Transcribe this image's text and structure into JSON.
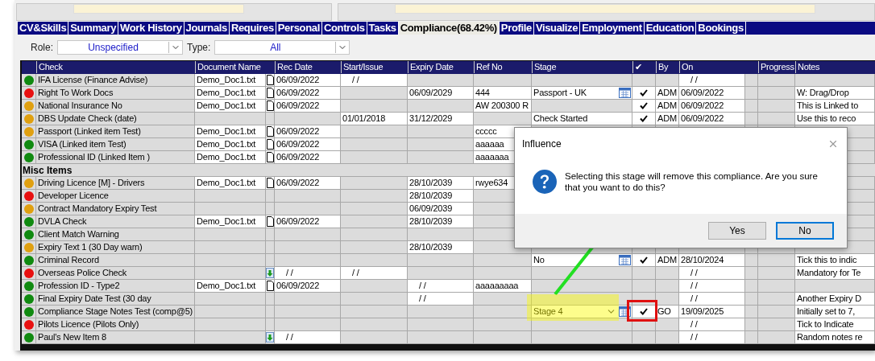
{
  "tabs": [
    {
      "label": "CV&Skills",
      "selected": false
    },
    {
      "label": "Summary",
      "selected": false
    },
    {
      "label": "Work History",
      "selected": false
    },
    {
      "label": "Journals",
      "selected": false
    },
    {
      "label": "Requires",
      "selected": false
    },
    {
      "label": "Personal",
      "selected": false
    },
    {
      "label": "Controls",
      "selected": false
    },
    {
      "label": "Tasks",
      "selected": false
    },
    {
      "label": "Compliance(68.42%)",
      "selected": true
    },
    {
      "label": "Profile",
      "selected": false
    },
    {
      "label": "Visualize",
      "selected": false
    },
    {
      "label": "Employment",
      "selected": false
    },
    {
      "label": "Education",
      "selected": false
    },
    {
      "label": "Bookings",
      "selected": false
    }
  ],
  "filters": {
    "role_label": "Role:",
    "role_value": "Unspecified",
    "type_label": "Type:",
    "type_value": "All"
  },
  "table": {
    "columns": [
      "Check",
      "Document Name",
      "Rec Date",
      "Start/Issue",
      "Expiry Date",
      "Ref No",
      "Stage",
      "✔",
      "By",
      "On",
      "Progress",
      "Notes"
    ],
    "rows": [
      {
        "kind": "item",
        "color": "#108a10",
        "check": "IFA License (Finance Advise)",
        "doc": "Demo_Doc1.txt",
        "attachment": {
          "kind": "file"
        },
        "rec": "06/09/2022",
        "start": "/   /",
        "on": "/   /",
        "verified": false
      },
      {
        "kind": "item",
        "color": "#e81010",
        "check": "Right To Work Docs",
        "doc": "Demo_Doc1.txt",
        "attachment": {
          "kind": "file"
        },
        "rec": "06/09/2022",
        "expiry": "06/09/2029",
        "ref": "444",
        "stage": "Passport - UK",
        "calendar": true,
        "verified": true,
        "by": "ADM",
        "on": "06/09/2022",
        "notes": "W: Drag/Drop"
      },
      {
        "kind": "item",
        "color": "#e0a010",
        "check": "National Insurance No",
        "doc": "Demo_Doc1.txt",
        "attachment": {
          "kind": "file"
        },
        "rec": "06/09/2022",
        "ref": "AW 200300 R",
        "verified": true,
        "by": "ADM",
        "on": "06/09/2022",
        "notes": "This is Linked to"
      },
      {
        "kind": "item",
        "color": "#e0a010",
        "check": "DBS Update Check (date)",
        "start": "01/01/2018",
        "expiry": "31/12/2029",
        "stage": "Check Started",
        "verified": true,
        "by": "ADM",
        "on": "06/09/2022",
        "notes": "Use this to reco"
      },
      {
        "kind": "item",
        "color": "#e0a010",
        "check": "Passport (Linked item Test)",
        "doc": "Demo_Doc1.txt",
        "attachment": {
          "kind": "file"
        },
        "rec": "06/09/2022",
        "ref": "ccccc"
      },
      {
        "kind": "item",
        "color": "#108a10",
        "check": "VISA (Linked item Test)",
        "doc": "Demo_Doc1.txt",
        "attachment": {
          "kind": "file"
        },
        "rec": "06/09/2022",
        "ref": "aaaaaa"
      },
      {
        "kind": "item",
        "color": "#108a10",
        "check": "Professional ID (Linked Item )",
        "doc": "Demo_Doc1.txt",
        "attachment": {
          "kind": "file"
        },
        "rec": "06/09/2022",
        "ref": "aaaaaaa"
      },
      {
        "kind": "group",
        "check": "Misc Items"
      },
      {
        "kind": "item",
        "color": "#e0a010",
        "check": "Driving Licence [M] - Drivers",
        "doc": "Demo_Doc1.txt",
        "attachment": {
          "kind": "file"
        },
        "rec": "06/09/2022",
        "expiry": "28/10/2039",
        "ref": "rwye634"
      },
      {
        "kind": "item",
        "color": "#e81010",
        "check": "Developer Licence",
        "expiry": "28/10/2039"
      },
      {
        "kind": "item",
        "color": "#e0a010",
        "check": "Contract Mandatory Expiry Test",
        "expiry": "06/09/2039"
      },
      {
        "kind": "item",
        "color": "#108a10",
        "check": "DVLA Check",
        "doc": "Demo_Doc1.txt",
        "attachment": {
          "kind": "file"
        },
        "rec": "06/09/2022",
        "expiry": "28/10/2039"
      },
      {
        "kind": "item",
        "color": "#108a10",
        "check": "Client Match Warning"
      },
      {
        "kind": "item",
        "color": "#e0a010",
        "check": "Expiry Text 1 (30 Day warn)",
        "expiry": "28/10/2039"
      },
      {
        "kind": "item",
        "color": "#108a10",
        "check": "Criminal Record",
        "stage": "No",
        "calendar": true,
        "verified": true,
        "by": "ADM",
        "on": "28/10/2024",
        "notes": "Tick this to indic"
      },
      {
        "kind": "item",
        "color": "#e81010",
        "check": "Overseas Police Check",
        "attachment": {
          "kind": "download"
        },
        "rec": "/   /",
        "start": "/   /",
        "on": "/   /",
        "notes": "Mandatory for Te",
        "verified": false
      },
      {
        "kind": "item",
        "color": "#108a10",
        "check": "Profession ID - Type2",
        "doc": "Demo_Doc1.txt",
        "attachment": {
          "kind": "file"
        },
        "rec": "06/09/2022",
        "expiry": "/   /",
        "ref": "aaaaaaaaa",
        "on": "/   /",
        "verified": false
      },
      {
        "kind": "item",
        "color": "#108a10",
        "check": "Final Expiry Date Test (30 day",
        "expiry": "/   /",
        "on": "/   /",
        "notes": "Another Expiry D",
        "verified": false
      },
      {
        "kind": "item",
        "color": "#108a10",
        "check": "Compliance Stage Notes Test (comp@5)",
        "stage": "Stage 4",
        "stage_control": {
          "kind": "dropdown"
        },
        "calendar": true,
        "verified": true,
        "by": "GO",
        "on": "19/09/2025",
        "notes": "Initially set to 7,"
      },
      {
        "kind": "item",
        "color": "#e81010",
        "check": "Pilots Licence (Pilots Only)",
        "on": "/   /",
        "notes": "Tick to Indicate",
        "verified": false
      },
      {
        "kind": "item",
        "color": "#108a10",
        "check": "Paul's New Item 8",
        "attachment": {
          "kind": "download"
        },
        "rec": "/   /",
        "on": "/   /",
        "notes": "Random notes re",
        "verified": false
      }
    ]
  },
  "dialog": {
    "title": "Influence",
    "message": "Selecting this stage will remove this compliance. Are you sure that you want to do this?",
    "buttons": [
      {
        "label": "Yes",
        "selected": false
      },
      {
        "label": "No",
        "selected": true
      }
    ]
  },
  "annotations": [
    {
      "kind": "arrow"
    },
    {
      "kind": "highlight"
    },
    {
      "kind": "outline"
    }
  ]
}
